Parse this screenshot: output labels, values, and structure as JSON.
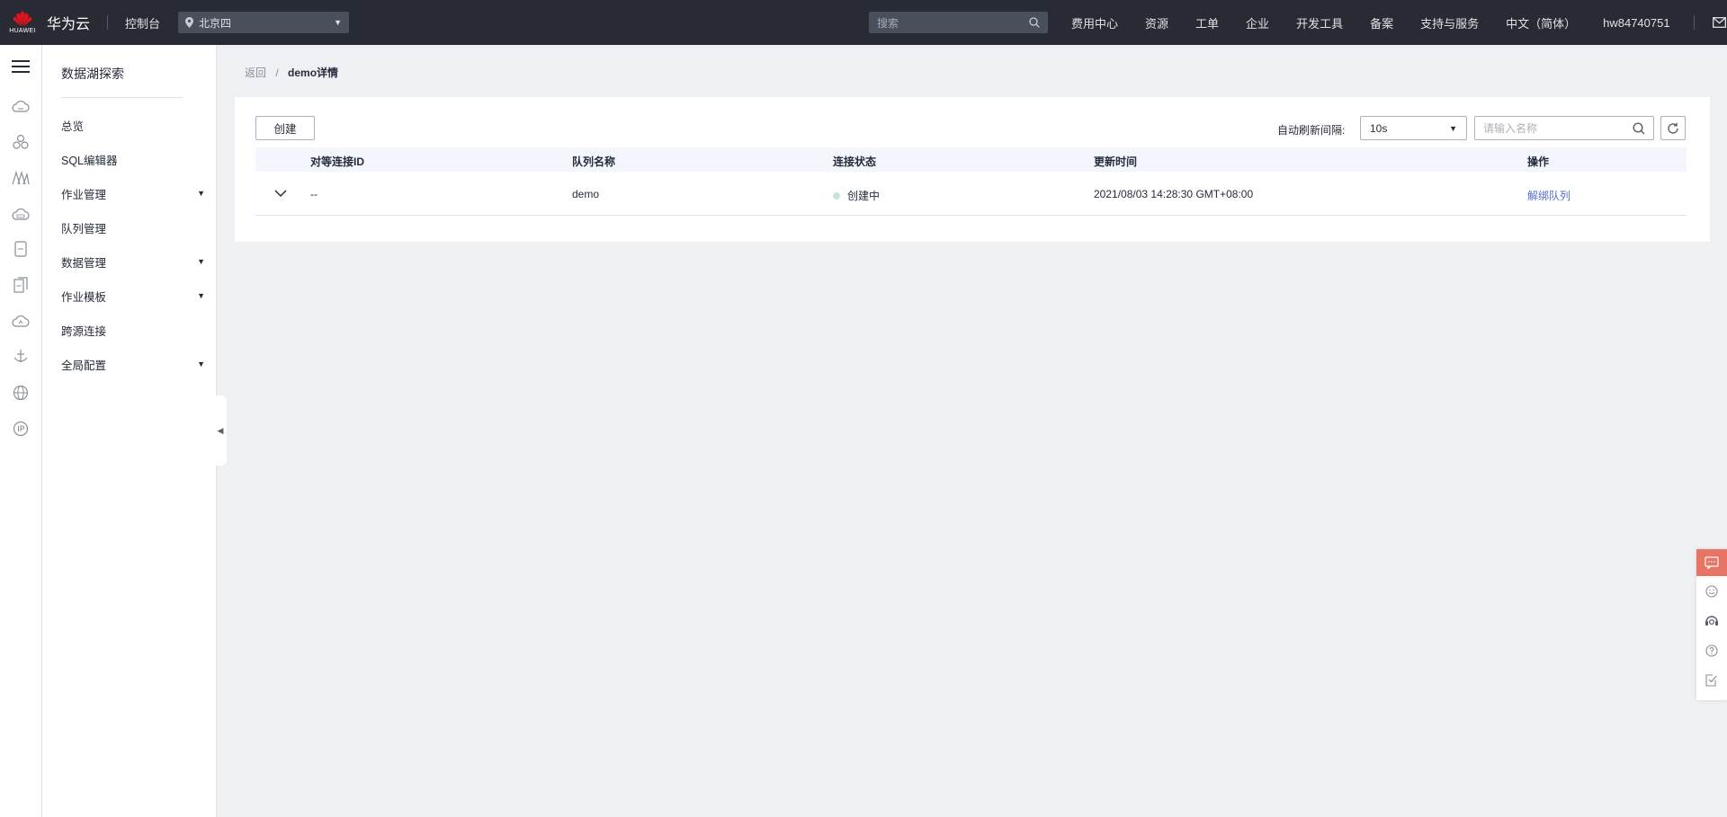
{
  "topbar": {
    "brand": "华为云",
    "logo_text": "HUAWEI",
    "console": "控制台",
    "region": "北京四",
    "search_placeholder": "搜索",
    "nav": [
      "费用中心",
      "资源",
      "工单",
      "企业",
      "开发工具",
      "备案",
      "支持与服务",
      "中文（简体）"
    ],
    "username": "hw84740751"
  },
  "rail_icons": [
    "cloud-server-icon",
    "cluster-icon",
    "data-lake-icon",
    "cdn-icon",
    "storage-icon",
    "document-icon",
    "cloud-icon",
    "anchor-icon",
    "globe-icon",
    "ip-icon"
  ],
  "menu": {
    "title": "数据湖探索",
    "items": [
      {
        "label": "总览",
        "has_children": false
      },
      {
        "label": "SQL编辑器",
        "has_children": false
      },
      {
        "label": "作业管理",
        "has_children": true
      },
      {
        "label": "队列管理",
        "has_children": false
      },
      {
        "label": "数据管理",
        "has_children": true
      },
      {
        "label": "作业模板",
        "has_children": true
      },
      {
        "label": "跨源连接",
        "has_children": false
      },
      {
        "label": "全局配置",
        "has_children": true
      }
    ]
  },
  "breadcrumb": {
    "back": "返回",
    "current": "demo详情"
  },
  "toolbar": {
    "create_label": "创建",
    "refresh_label": "自动刷新间隔:",
    "refresh_value": "10s",
    "search_placeholder": "请输入名称"
  },
  "table": {
    "columns": [
      "对等连接ID",
      "队列名称",
      "连接状态",
      "更新时间",
      "操作"
    ],
    "rows": [
      {
        "peer_id": "--",
        "queue": "demo",
        "status": "创建中",
        "updated": "2021/08/03 14:28:30 GMT+08:00",
        "action": "解绑队列"
      }
    ]
  },
  "colors": {
    "topbar_bg": "#282b33",
    "link": "#526ecc",
    "status_creating": "#c5e4d3",
    "float_active": "#e87466"
  },
  "float_bar": [
    "chat-icon",
    "smile-icon",
    "headset-icon",
    "help-icon",
    "checklist-icon"
  ]
}
